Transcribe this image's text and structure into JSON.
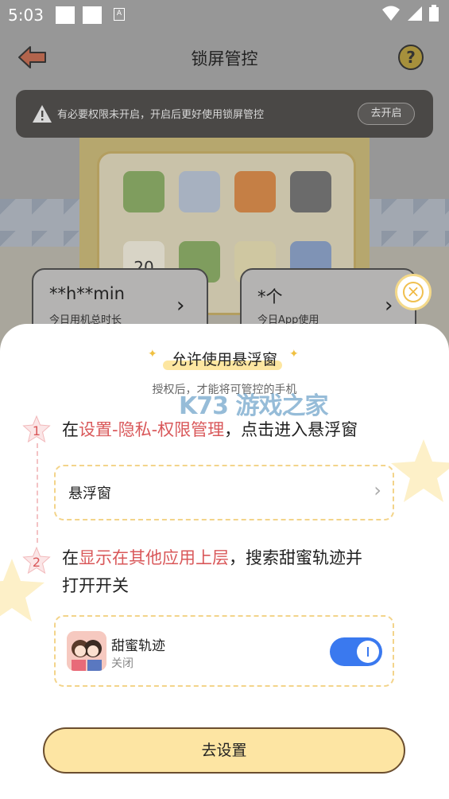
{
  "status_bar": {
    "time": "5:03",
    "icons": [
      "wifi-icon",
      "signal-icon",
      "battery-icon"
    ]
  },
  "header": {
    "title": "锁屏管控",
    "back_icon": "back-arrow-icon",
    "help_icon": "help-icon",
    "help_glyph": "?"
  },
  "banner": {
    "text": "有必要权限未开启，开启后更好使用锁屏管控",
    "button": "去开启"
  },
  "phone_preview": {
    "calendar_day": "20"
  },
  "stats": [
    {
      "value": "**h**min",
      "label": "今日用机总时长"
    },
    {
      "value": "*个",
      "label": "今日App使用"
    }
  ],
  "sheet": {
    "title": "允许使用悬浮窗",
    "subtitle": "授权后，才能将可管控的手机",
    "watermark": "K73 游戏之家",
    "steps": [
      {
        "number": "1",
        "prefix": "在",
        "highlight": "设置-隐私-权限管理",
        "suffix": "，点击进入悬浮窗"
      },
      {
        "number": "2",
        "prefix": "在",
        "highlight": "显示在其他应用上层",
        "suffix": "，搜索甜蜜轨迹并",
        "line2": "打开开关"
      }
    ],
    "setting_row": {
      "label": "悬浮窗",
      "chevron": "›"
    },
    "app_row": {
      "name": "甜蜜轨迹",
      "status": "关闭",
      "toggle_on": true
    },
    "action_button": "去设置"
  },
  "colors": {
    "accent": "#d9585a",
    "toggle": "#3a79ef",
    "button_bg": "#fde5a3",
    "dashed_border": "#f3d48a"
  }
}
